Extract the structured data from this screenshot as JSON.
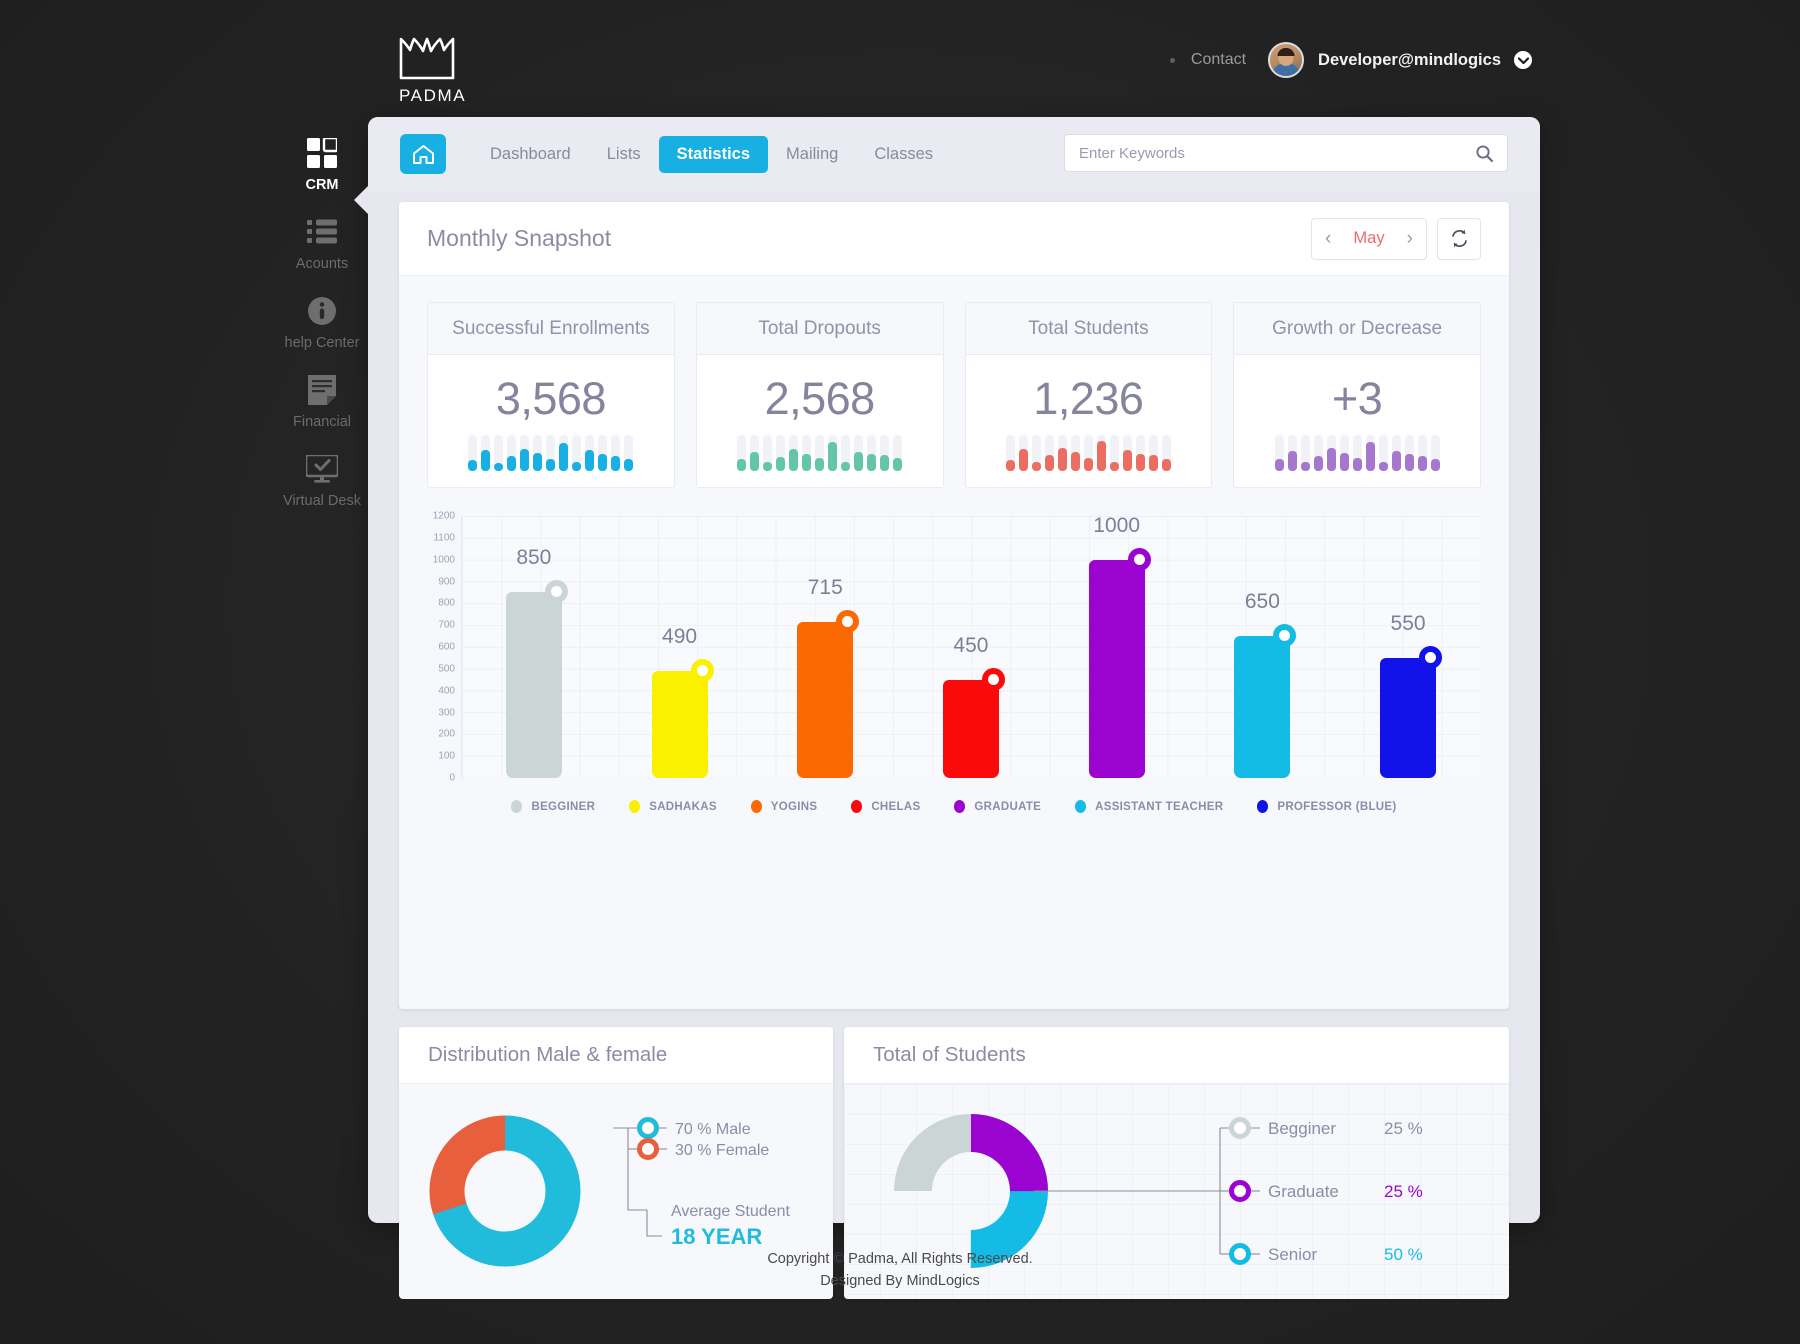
{
  "brand": {
    "name": "PADMA",
    "logo_icon": "lotus-logo-icon"
  },
  "header": {
    "contact_label": "Contact",
    "username": "Developer@mindlogics",
    "chevron_icon": "chevron-down-icon",
    "avatar_icon": "user-avatar"
  },
  "sidebar": {
    "items": [
      {
        "label": "CRM",
        "icon": "grid-icon",
        "active": true
      },
      {
        "label": "Acounts",
        "icon": "list-icon",
        "active": false
      },
      {
        "label": "help Center",
        "icon": "info-icon",
        "active": false
      },
      {
        "label": "Financial",
        "icon": "document-icon",
        "active": false
      },
      {
        "label": "Virtual Desk",
        "icon": "monitor-check-icon",
        "active": false
      }
    ]
  },
  "nav": {
    "home_icon": "home-icon",
    "links": [
      {
        "label": "Dashboard",
        "active": false
      },
      {
        "label": "Lists",
        "active": false
      },
      {
        "label": "Statistics",
        "active": true
      },
      {
        "label": "Mailing",
        "active": false
      },
      {
        "label": "Classes",
        "active": false
      }
    ]
  },
  "search": {
    "placeholder": "Enter Keywords",
    "value": "",
    "icon": "search-icon"
  },
  "snapshot": {
    "title": "Monthly Snapshot",
    "month": "May",
    "prev_icon": "chevron-left-icon",
    "next_icon": "chevron-right-icon",
    "refresh_icon": "refresh-icon"
  },
  "stats": [
    {
      "label": "Successful Enrollments",
      "value": "3,568",
      "color": "#18b0e2",
      "spark": [
        30,
        58,
        22,
        42,
        62,
        50,
        34,
        78,
        26,
        58,
        46,
        42,
        34
      ]
    },
    {
      "label": "Total Dropouts",
      "value": "2,568",
      "color": "#63c6a8",
      "spark": [
        34,
        52,
        24,
        40,
        62,
        48,
        36,
        80,
        26,
        54,
        46,
        44,
        36
      ]
    },
    {
      "label": "Total Students",
      "value": "1,236",
      "color": "#ec6e63",
      "spark": [
        30,
        60,
        24,
        44,
        64,
        52,
        36,
        82,
        26,
        58,
        48,
        44,
        34
      ]
    },
    {
      "label": "Growth or Decrease",
      "value": "+3",
      "color": "#a islands",
      "spark": [
        34,
        56,
        24,
        42,
        64,
        50,
        36,
        80,
        26,
        56,
        46,
        42,
        34
      ]
    }
  ],
  "stat_colors": [
    "#18b0e2",
    "#63c6a8",
    "#ec6e63",
    "#a577cf"
  ],
  "chart_data": {
    "type": "bar",
    "title": "",
    "categories": [
      "BEGGINER",
      "SADHAKAS",
      "YOGINS",
      "CHELAS",
      "GRADUATE",
      "ASSISTANT TEACHER",
      "PROFESSOR (BLUE)"
    ],
    "values": [
      850,
      490,
      715,
      450,
      1000,
      650,
      550
    ],
    "colors": [
      "#ccd5d5",
      "#faf000",
      "#fb6a02",
      "#fa0a0a",
      "#9b03d1",
      "#14bbe5",
      "#1212ea"
    ],
    "ylim": [
      0,
      1200
    ],
    "yticks": [
      1200,
      1100,
      1000,
      900,
      800,
      700,
      600,
      500,
      400,
      300,
      200,
      100,
      0
    ],
    "ylabel": "",
    "xlabel": "",
    "grid": true,
    "legend_position": "bottom"
  },
  "distribution": {
    "title": "Distribution Male & female",
    "chart_data": {
      "type": "pie",
      "labels": [
        "70 % Male",
        "30 % Female"
      ],
      "values": [
        70,
        30
      ],
      "colors": [
        "#21bcdc",
        "#e85f3d"
      ]
    },
    "average_caption": "Average Student",
    "average_value": "18 YEAR",
    "average_color": "#21bcdc"
  },
  "total_students": {
    "title": "Total of Students",
    "chart_data": {
      "type": "pie",
      "labels": [
        "Begginer",
        "Graduate",
        "Senior"
      ],
      "values": [
        25,
        25,
        50
      ],
      "value_labels": [
        "25 %",
        "25 %",
        "50 %"
      ],
      "colors": [
        "#ccd5d5",
        "#9b03d1",
        "#14bbe5"
      ],
      "label_colors": [
        "#8c8ca4",
        "#9b03d1",
        "#14bbe5"
      ]
    }
  },
  "footer": {
    "line1": "Copyright © Padma, All Rights Reserved.",
    "line2": "Designed By MindLogics"
  }
}
